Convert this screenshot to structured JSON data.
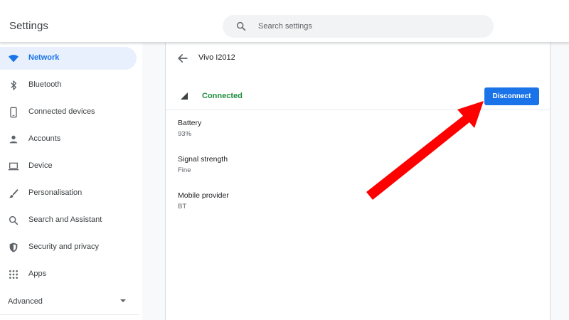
{
  "header": {
    "title": "Settings",
    "search": {
      "placeholder": "Search settings",
      "value": "",
      "icon": "search-icon"
    }
  },
  "sidebar": {
    "items": [
      {
        "label": "Network",
        "icon": "wifi-icon",
        "active": true
      },
      {
        "label": "Bluetooth",
        "icon": "bluetooth-icon"
      },
      {
        "label": "Connected devices",
        "icon": "phone-icon"
      },
      {
        "label": "Accounts",
        "icon": "person-icon"
      },
      {
        "label": "Device",
        "icon": "laptop-icon"
      },
      {
        "label": "Personalisation",
        "icon": "brush-icon"
      },
      {
        "label": "Search and Assistant",
        "icon": "search-icon"
      },
      {
        "label": "Security and privacy",
        "icon": "shield-icon"
      },
      {
        "label": "Apps",
        "icon": "apps-grid-icon"
      }
    ],
    "advanced": {
      "label": "Advanced",
      "icon": "caret-down-icon"
    }
  },
  "detail": {
    "network_name": "Vivo I2012",
    "status": "Connected",
    "disconnect_label": "Disconnect",
    "properties": [
      {
        "label": "Battery",
        "value": "93%"
      },
      {
        "label": "Signal strength",
        "value": "Fine"
      },
      {
        "label": "Mobile provider",
        "value": "BT"
      }
    ]
  },
  "colors": {
    "accent": "#1a73e8",
    "active_bg": "#e8f0fe",
    "connected": "#1e8e3e",
    "annotation": "#ff0000"
  }
}
